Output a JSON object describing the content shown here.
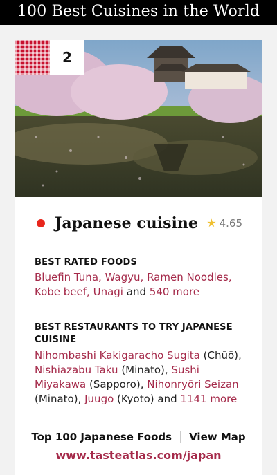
{
  "header": {
    "title": "100 Best Cuisines in the World"
  },
  "card": {
    "rank": "2",
    "title": "Japanese cuisine",
    "rating": "4.65",
    "best_foods": {
      "heading": "BEST RATED FOODS",
      "items": [
        "Bluefin Tuna",
        "Wagyu",
        "Ramen Noodles",
        "Kobe beef",
        "Unagi"
      ],
      "and": "and",
      "more": "540 more"
    },
    "best_restaurants": {
      "heading_line1": "BEST RESTAURANTS TO TRY JAPANESE",
      "heading_line2": "CUISINE",
      "r1": "Nihombashi Kakigaracho Sugita",
      "r1_loc": "(Chūō),",
      "r2": "Nishiazabu Taku",
      "r2_loc": "(Minato),",
      "r3a": "Sushi",
      "r3b": "Miyakawa",
      "r3_loc": "(Sapporo),",
      "r4": "Nihonryōri Seizan",
      "r4_loc": "(Minato),",
      "r5": "Juugo",
      "r5_loc": "(Kyoto) and",
      "more": "1141 more"
    },
    "footer": {
      "top100": "Top 100 Japanese Foods",
      "map": "View Map",
      "url": "www.tasteatlas.com/japan"
    }
  },
  "colors": {
    "accent": "#a52a4a",
    "dot": "#e8261c",
    "checker": "#c8102e"
  },
  "icons": {
    "rating": "star-icon"
  }
}
